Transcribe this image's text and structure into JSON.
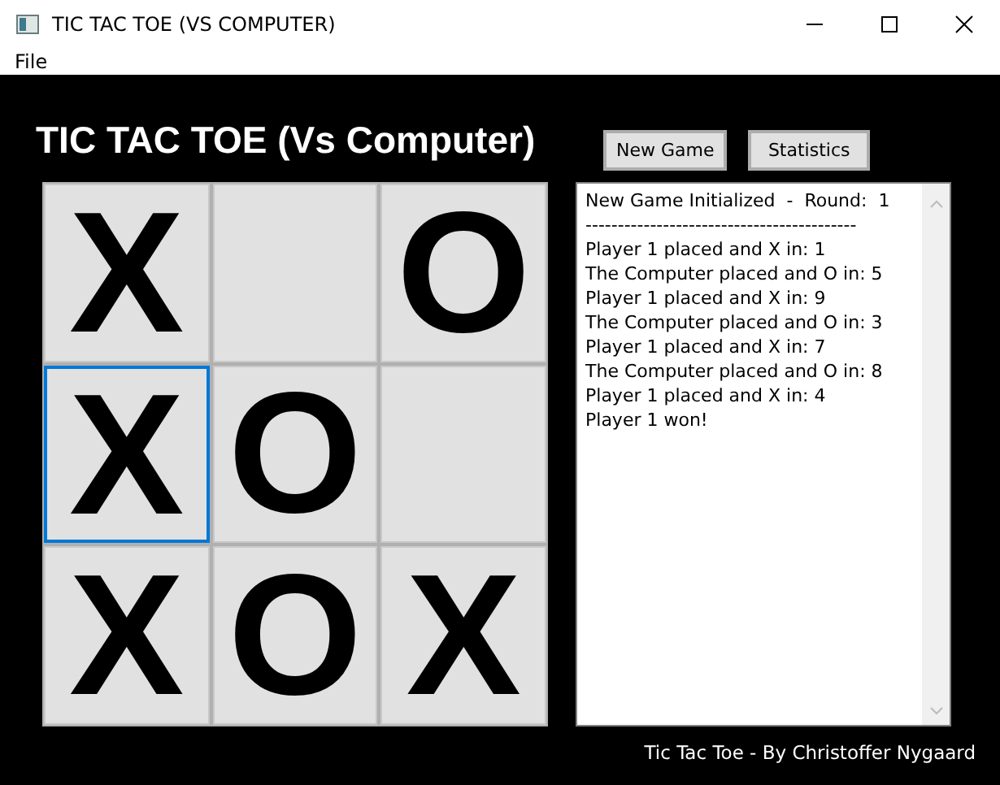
{
  "window": {
    "title": "TIC TAC TOE (VS COMPUTER)"
  },
  "menu": [
    "File"
  ],
  "heading": "TIC TAC TOE (Vs Computer)",
  "buttons": [
    "New Game",
    "Statistics"
  ],
  "board": [
    {
      "mark": "X",
      "focused": false
    },
    {
      "focused": false
    },
    {
      "mark": "O",
      "focused": false
    },
    {
      "mark": "X",
      "focused": true
    },
    {
      "mark": "O",
      "focused": false
    },
    {
      "focused": false
    },
    {
      "mark": "X",
      "focused": false
    },
    {
      "mark": "O",
      "focused": false
    },
    {
      "mark": "X",
      "focused": false
    }
  ],
  "log": [
    "New Game Initialized  -  Round:  1",
    "------------------------------------------",
    "Player 1 placed and X in: 1",
    "The Computer placed and O in: 5",
    "Player 1 placed and X in: 9",
    "The Computer placed and O in: 3",
    "Player 1 placed and X in: 7",
    "The Computer placed and O in: 8",
    "Player 1 placed and X in: 4",
    "Player 1 won!"
  ],
  "footer": "Tic Tac Toe - By Christoffer Nygaard"
}
